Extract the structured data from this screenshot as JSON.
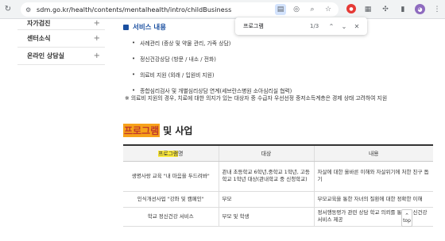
{
  "browser": {
    "url": "sdm.go.kr/health/contents/mentalhealth/intro/childBusiness",
    "find_query": "프로그램",
    "find_count": "1/3"
  },
  "sidebar": {
    "items": [
      {
        "label": "자가검진"
      },
      {
        "label": "센터소식"
      },
      {
        "label": "온라인 상담실"
      }
    ]
  },
  "main": {
    "service_title": "서비스 내용",
    "bullets": [
      "사례관리 (증상 및 약물 관리, 가족 상담)",
      "정신건강상담 (방문 / 내소 / 전화)",
      "의료비 지원 (외래 / 입원비 지원)",
      "종합심리검사 및 개별심리상담 연계(세브란스병원 소아심리실 협력)"
    ],
    "note": "※ 의료비 지원의 경우, 치료에 대한 의지가 있는 대상자 중 수급자 우선선정 중저소득계층은 경제 상태 고려하여 지원",
    "section_title_hl": "프로그램",
    "section_title_rest": "및 사업"
  },
  "table": {
    "headers": {
      "program_hl": "프로그램",
      "program_suffix": "명",
      "target": "대상",
      "content": "내용"
    },
    "rows": [
      {
        "program": "생명사랑 교육 \"내 마음을 두드려봐\"",
        "target": "관내 초등학교 6학년,중학교 1학년, 고등학교 1학년 대상(관내학교 중 신청학교)",
        "content": "자살에 대한 올바른 이해와 자살위기에 처한 친구 돕기"
      },
      {
        "program": "인식개선사업 \"강좌 및 캠페인\"",
        "target": "부모",
        "content": "부모교육을 통한 자녀의 질환에 대한 정확한 이해"
      },
      {
        "program": "학교 정신건강 서비스",
        "target": "부모 및 학생",
        "content": "정서행동평가 관련 상담 학교 의뢰를 통한 정신건강 서비스 제공"
      }
    ]
  },
  "scroll_top_label": "top"
}
